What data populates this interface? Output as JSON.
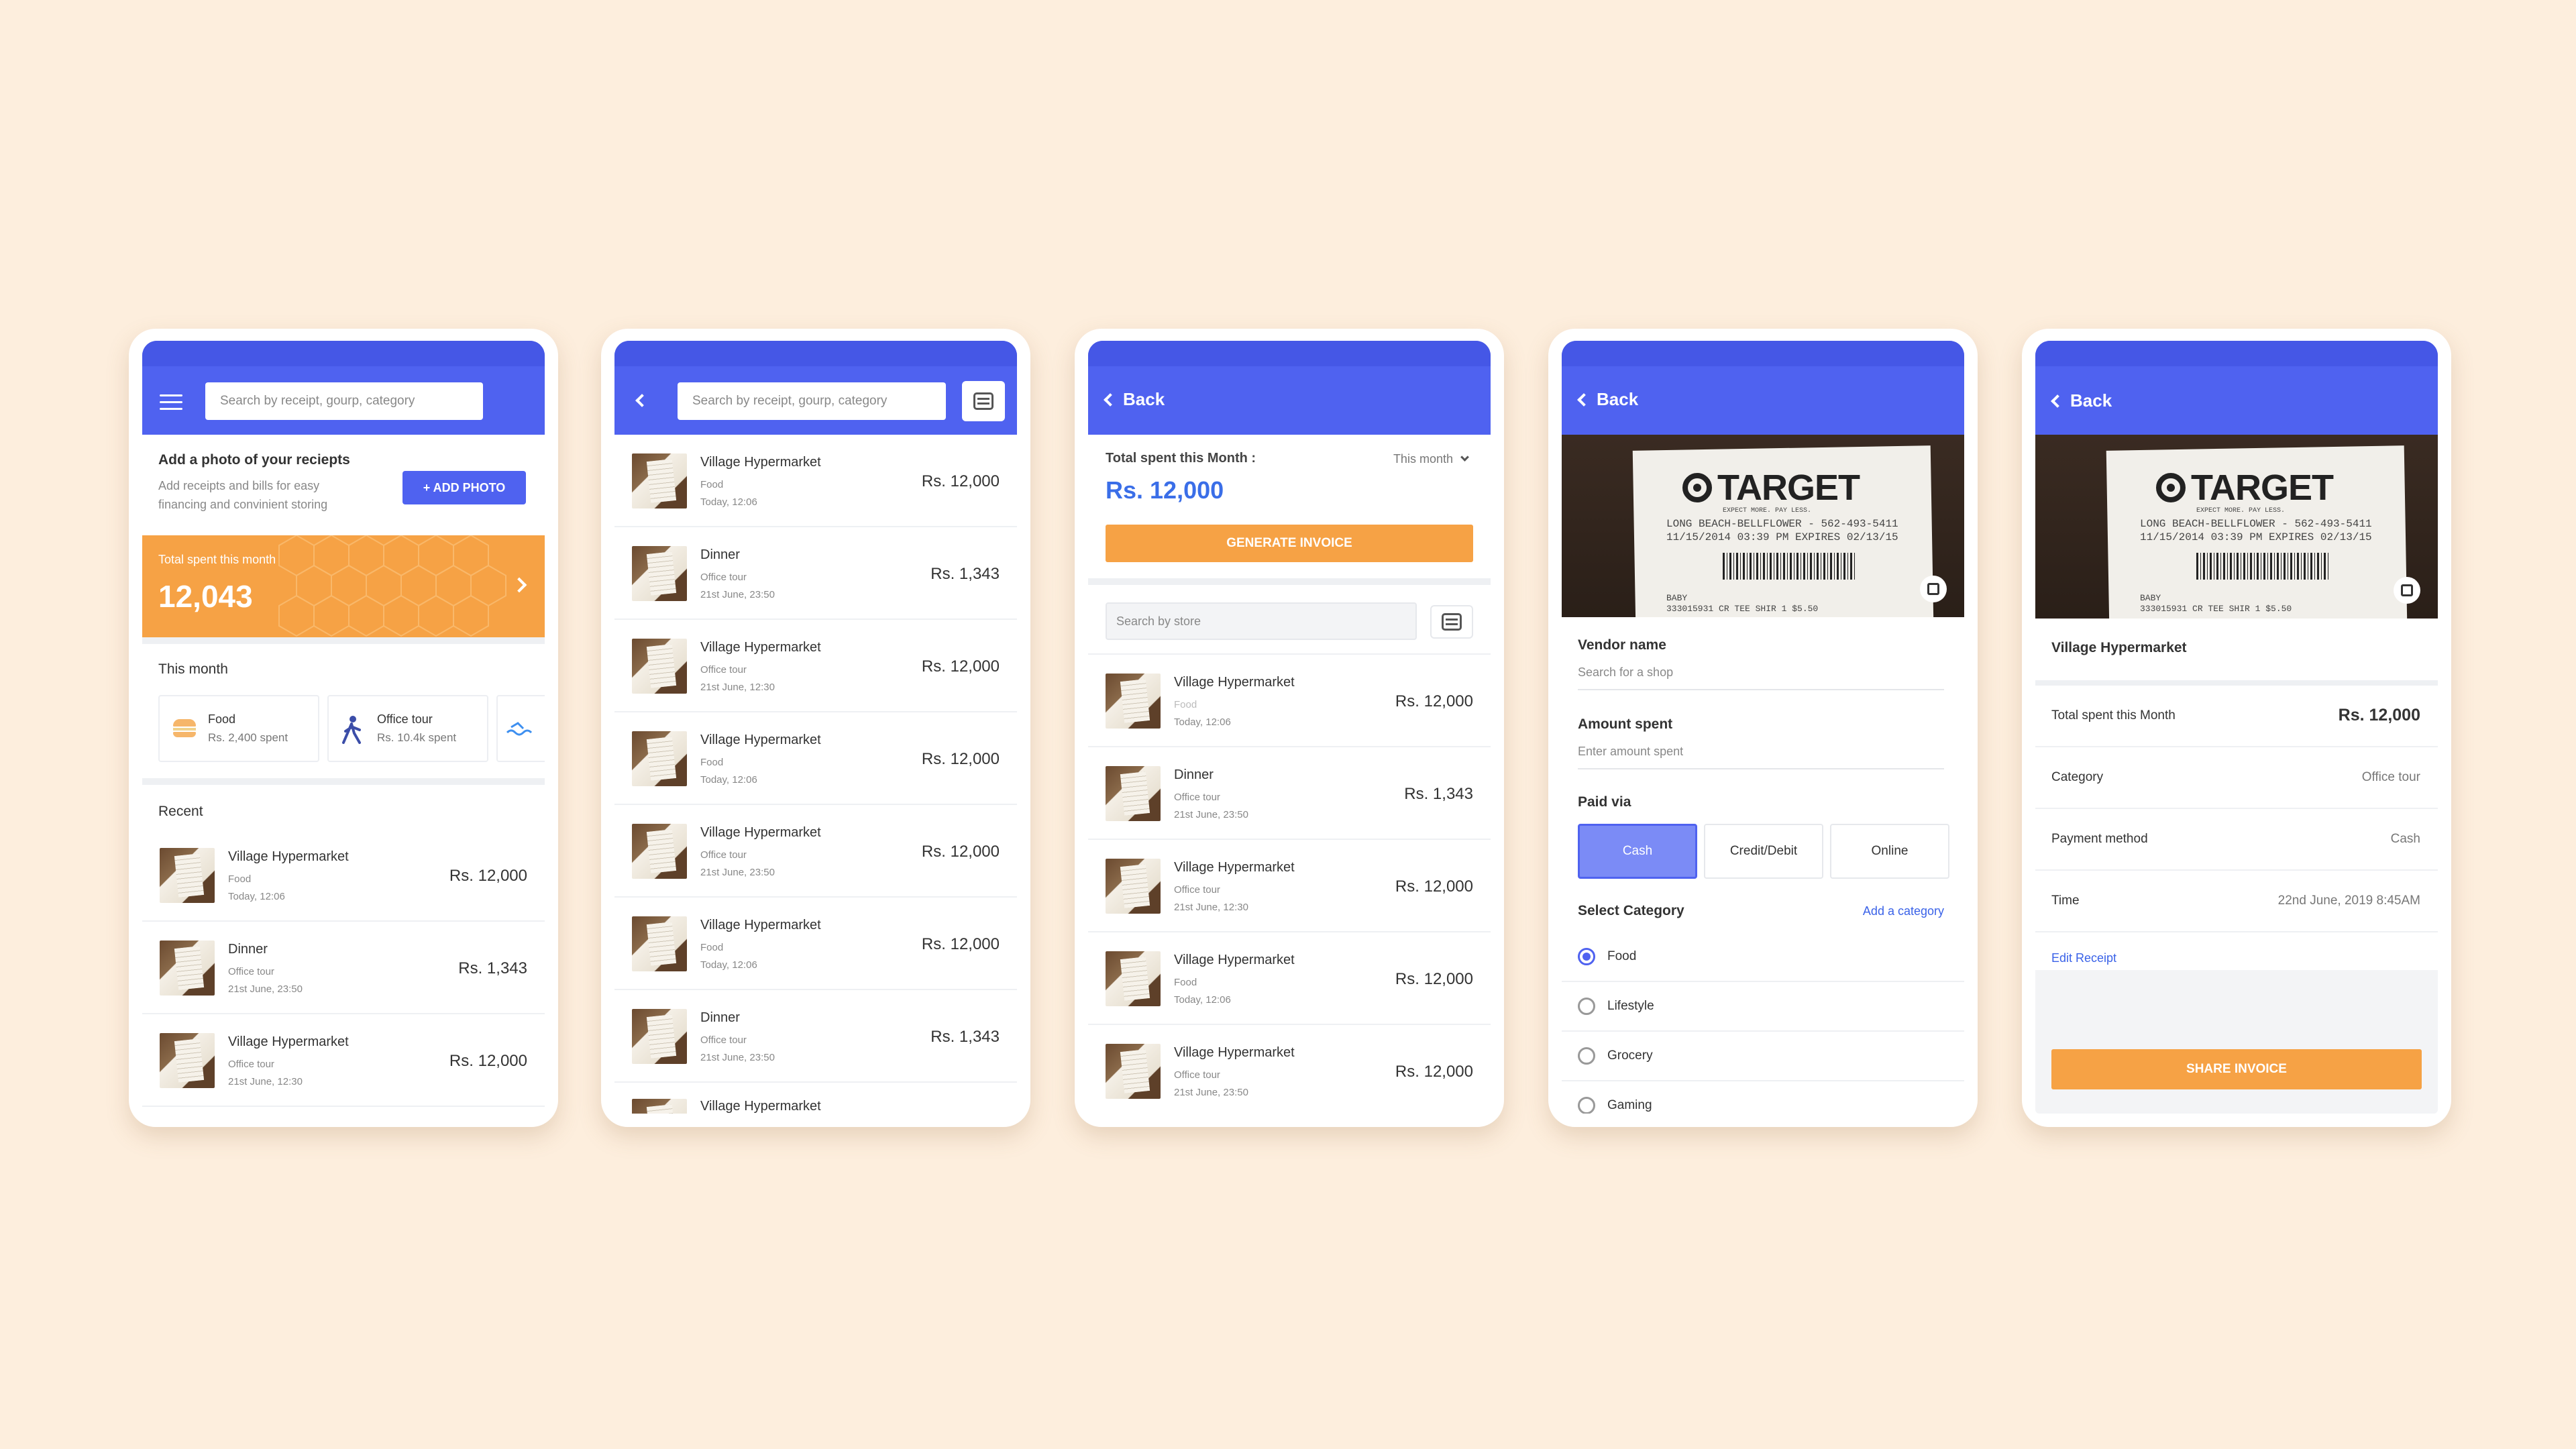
{
  "colors": {
    "primary": "#4f62f0",
    "accent": "#f6a245",
    "background": "#fdeedd"
  },
  "screen1": {
    "search_placeholder": "Search by receipt, gourp, category",
    "add_photo_title": "Add a photo of your reciepts",
    "add_photo_desc_1": "Add receipts and bills for easy",
    "add_photo_desc_2": "financing and convinient storing",
    "add_photo_button": "+ ADD PHOTO",
    "total_label": "Total spent this month",
    "total_value": "12,043",
    "this_month_label": "This month",
    "categories": [
      {
        "name": "Food",
        "spent": "Rs. 2,400 spent",
        "icon": "burger-icon"
      },
      {
        "name": "Office tour",
        "spent": "Rs. 10.4k spent",
        "icon": "walking-person-icon"
      }
    ],
    "recent_label": "Recent",
    "recent": [
      {
        "title": "Village Hypermarket",
        "sub": "Food",
        "date": "Today, 12:06",
        "amount": "Rs. 12,000"
      },
      {
        "title": "Dinner",
        "sub": "Office tour",
        "date": "21st June, 23:50",
        "amount": "Rs. 1,343"
      },
      {
        "title": "Village Hypermarket",
        "sub": "Office tour",
        "date": "21st June, 12:30",
        "amount": "Rs. 12,000"
      }
    ]
  },
  "screen2": {
    "search_placeholder": "Search by receipt, gourp, category",
    "rows": [
      {
        "title": "Village Hypermarket",
        "sub": "Food",
        "date": "Today, 12:06",
        "amount": "Rs. 12,000"
      },
      {
        "title": "Dinner",
        "sub": "Office tour",
        "date": "21st June, 23:50",
        "amount": "Rs. 1,343"
      },
      {
        "title": "Village Hypermarket",
        "sub": "Office tour",
        "date": "21st June, 12:30",
        "amount": "Rs. 12,000"
      },
      {
        "title": "Village Hypermarket",
        "sub": "Food",
        "date": "Today, 12:06",
        "amount": "Rs. 12,000"
      },
      {
        "title": "Village Hypermarket",
        "sub": "Office tour",
        "date": "21st June, 23:50",
        "amount": "Rs. 12,000"
      },
      {
        "title": "Village Hypermarket",
        "sub": "Food",
        "date": "Today, 12:06",
        "amount": "Rs. 12,000"
      },
      {
        "title": "Dinner",
        "sub": "Office tour",
        "date": "21st June, 23:50",
        "amount": "Rs. 1,343"
      }
    ],
    "partial_row_title": "Village Hypermarket"
  },
  "screen3": {
    "back_label": "Back",
    "total_label": "Total spent this Month :",
    "period": "This month",
    "total_value": "Rs. 12,000",
    "generate_button": "GENERATE INVOICE",
    "store_search_placeholder": "Search by store",
    "rows": [
      {
        "title": "Village Hypermarket",
        "sub": "Food",
        "date": "Today, 12:06",
        "amount": "Rs. 12,000"
      },
      {
        "title": "Dinner",
        "sub": "Office tour",
        "date": "21st June, 23:50",
        "amount": "Rs. 1,343"
      },
      {
        "title": "Village Hypermarket",
        "sub": "Office tour",
        "date": "21st June, 12:30",
        "amount": "Rs. 12,000"
      },
      {
        "title": "Village Hypermarket",
        "sub": "Food",
        "date": "Today, 12:06",
        "amount": "Rs. 12,000"
      },
      {
        "title": "Village Hypermarket",
        "sub": "Office tour",
        "date": "21st June, 23:50",
        "amount": "Rs. 12,000"
      }
    ]
  },
  "receipt_image": {
    "brand": "TARGET",
    "tagline": "EXPECT MORE. PAY LESS.",
    "line1": "LONG BEACH-BELLFLOWER - 562-493-5411",
    "line2": "11/15/2014 03:39 PM   EXPIRES 02/13/15",
    "line3": "BABY",
    "line4": "333015931    CR TEE SHIR   1   $5.50"
  },
  "screen4": {
    "back_label": "Back",
    "vendor_label": "Vendor name",
    "vendor_placeholder": "Search for a shop",
    "amount_label": "Amount spent",
    "amount_placeholder": "Enter amount spent",
    "paid_via_label": "Paid via",
    "pay_options": [
      "Cash",
      "Credit/Debit",
      "Online"
    ],
    "selected_pay": "Cash",
    "category_label": "Select Category",
    "add_category": "Add a category",
    "categories": [
      "Food",
      "Lifestyle",
      "Grocery",
      "Gaming"
    ],
    "selected_category": "Food"
  },
  "screen5": {
    "back_label": "Back",
    "vendor": "Village Hypermarket",
    "total_label": "Total spent this Month",
    "total_value": "Rs. 12,000",
    "category_label": "Category",
    "category_value": "Office tour",
    "payment_label": "Payment method",
    "payment_value": "Cash",
    "time_label": "Time",
    "time_value": "22nd June, 2019 8:45AM",
    "edit_link": "Edit Receipt",
    "share_button": "SHARE INVOICE"
  }
}
